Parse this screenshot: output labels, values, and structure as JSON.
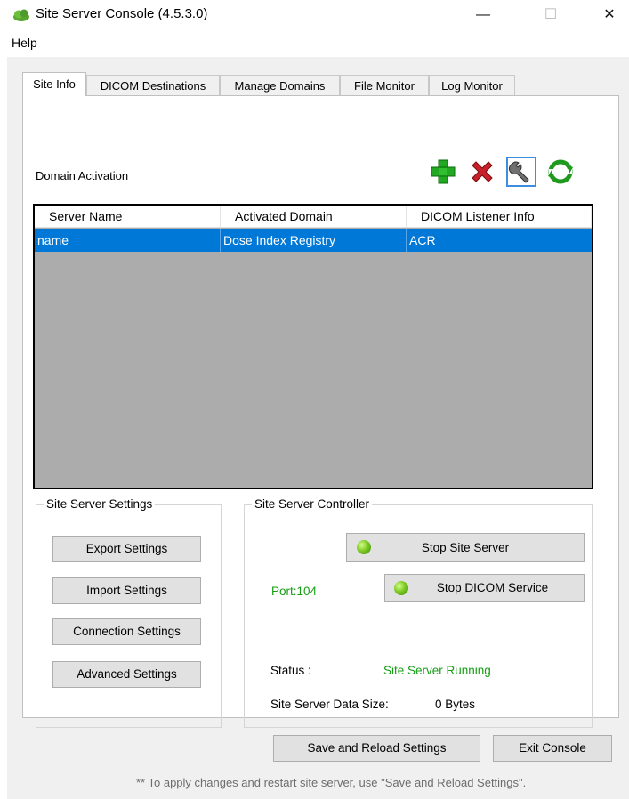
{
  "window": {
    "title": "Site Server Console (4.5.3.0)",
    "minimize_glyph": "—",
    "maximize_glyph": "☐",
    "close_glyph": "✕"
  },
  "menu": [
    "Help"
  ],
  "tabs": [
    {
      "label": "Site Info",
      "active": true
    },
    {
      "label": "DICOM Destinations",
      "active": false
    },
    {
      "label": "Manage Domains",
      "active": false
    },
    {
      "label": "File Monitor",
      "active": false
    },
    {
      "label": "Log Monitor",
      "active": false
    }
  ],
  "domain_activation": {
    "label": "Domain Activation",
    "toolbar_icons": [
      "add-icon",
      "delete-icon",
      "wrench-icon",
      "refresh-icon"
    ],
    "columns": [
      "Server Name",
      "Activated Domain",
      "DICOM Listener Info"
    ],
    "rows": [
      {
        "server_name": "name",
        "activated_domain": "Dose Index Registry",
        "listener_info": "ACR",
        "selected": true
      }
    ]
  },
  "site_server_settings": {
    "title": "Site Server Settings",
    "buttons": [
      "Export Settings",
      "Import Settings",
      "Connection Settings",
      "Advanced Settings"
    ]
  },
  "site_server_controller": {
    "title": "Site Server Controller",
    "stop_server_label": "Stop Site Server",
    "stop_dicom_label": "Stop DICOM Service",
    "port_text": "Port:104",
    "status_label": "Status  :",
    "status_value": "Site Server Running",
    "data_size_label": "Site Server Data Size:",
    "data_size_value": "0 Bytes"
  },
  "footer": {
    "save_label": "Save and Reload Settings",
    "exit_label": "Exit Console",
    "hint": "** To apply changes and restart site server, use \"Save and Reload Settings\"."
  },
  "colors": {
    "selection": "#0078d7",
    "status_green": "#149e14",
    "list_background": "#acacac"
  }
}
